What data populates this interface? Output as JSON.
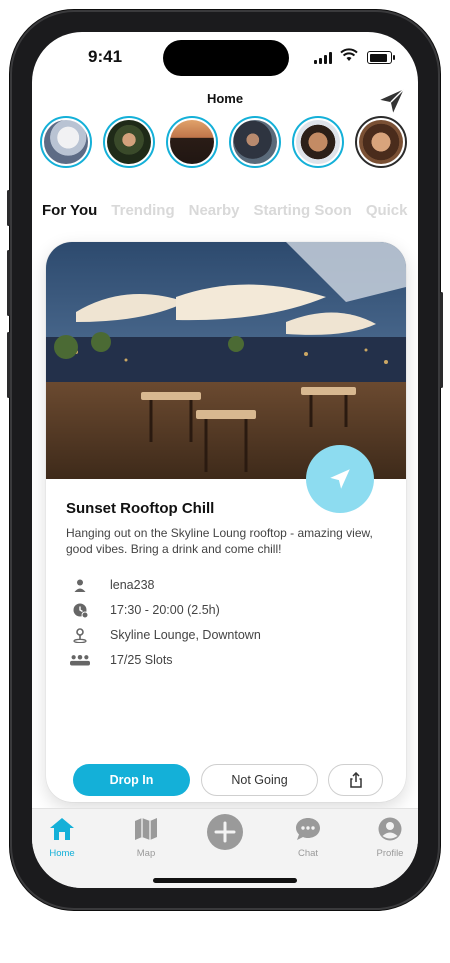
{
  "status": {
    "time": "9:41"
  },
  "header": {
    "title": "Home",
    "send_icon": "paper-plane-icon"
  },
  "stories": [
    {
      "name": "story-1"
    },
    {
      "name": "story-2"
    },
    {
      "name": "story-3"
    },
    {
      "name": "story-4"
    },
    {
      "name": "story-5"
    },
    {
      "name": "story-6"
    },
    {
      "name": "story-7"
    }
  ],
  "tabs": [
    "For You",
    "Trending",
    "Nearby",
    "Starting Soon",
    "Quick"
  ],
  "event": {
    "title": "Sunset Rooftop Chill",
    "description": "Hanging out on the Skyline Loung rooftop - amazing view, good vibes. Bring a drink and come chill!",
    "host": "lena238",
    "time": "17:30 - 20:00 (2.5h)",
    "location": "Skyline Lounge, Downtown",
    "slots": "17/25 Slots"
  },
  "actions": {
    "drop_in": "Drop In",
    "not_going": "Not Going",
    "share_icon": "share-icon"
  },
  "tabbar": [
    {
      "label": "Home",
      "icon": "home-icon",
      "active": true
    },
    {
      "label": "Map",
      "icon": "map-icon",
      "active": false
    },
    {
      "label": "",
      "icon": "plus-circle-icon",
      "active": false
    },
    {
      "label": "Chat",
      "icon": "chat-icon",
      "active": false
    },
    {
      "label": "Profile",
      "icon": "profile-icon",
      "active": false
    }
  ],
  "colors": {
    "accent": "#14b0d8",
    "fab": "#8ddcf0"
  }
}
